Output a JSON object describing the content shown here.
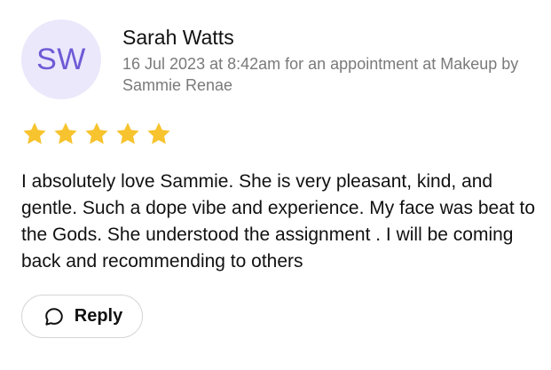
{
  "review": {
    "avatar_initials": "SW",
    "reviewer_name": "Sarah Watts",
    "meta": "16 Jul 2023 at 8:42am for an appointment at Makeup by Sammie Renae",
    "rating": 5,
    "rating_max": 5,
    "text": "I absolutely love Sammie. She is very pleasant, kind, and gentle. Such a dope vibe and experience. My face was beat to the Gods. She understood the assignment . I will be coming back and recommending to others",
    "reply_label": "Reply",
    "reply_icon": "chat-bubble-icon",
    "star_icon": "star-icon"
  },
  "colors": {
    "avatar_bg": "#ebe8fb",
    "avatar_text": "#6e5ad6",
    "star": "#f7c32e",
    "meta_text": "#7a7a7a",
    "button_border": "#d4d4d4"
  }
}
